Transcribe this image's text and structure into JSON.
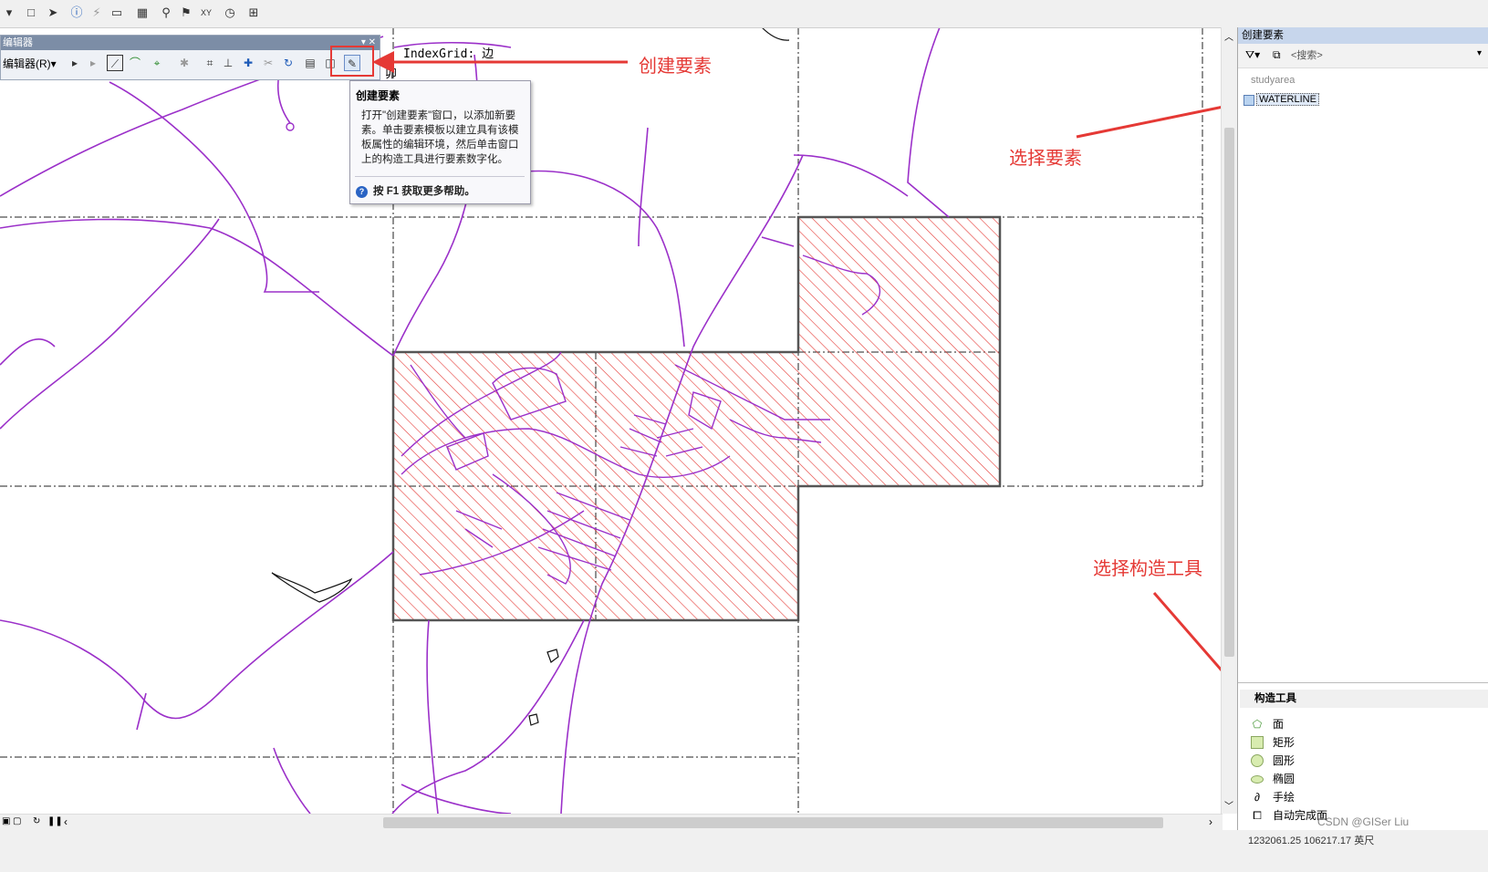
{
  "editor": {
    "title": "编辑器",
    "menu_label": "编辑器(R)▾"
  },
  "tooltip": {
    "title": "创建要素",
    "body": "打开\"创建要素\"窗口，以添加新要素。单击要素模板以建立具有该模板属性的编辑环境，然后单击窗口上的构造工具进行要素数字化。",
    "help": "按 F1 获取更多帮助。"
  },
  "map": {
    "indexgrid_label": "IndexGrid: 边",
    "indexgrid_label2": "卯"
  },
  "annotations": {
    "create_feature": "创建要素",
    "select_feature": "选择要素",
    "select_tool": "选择构造工具"
  },
  "right_panel": {
    "title": "创建要素",
    "search_placeholder": "<搜索>",
    "layers": [
      "studyarea",
      "WATERLINE"
    ],
    "construction_tools_header": "构造工具",
    "tools": [
      "面",
      "矩形",
      "圆形",
      "椭圆",
      "手绘",
      "自动完成面"
    ]
  },
  "status": {
    "coords": "1232061.25  106217.17 英尺",
    "watermark": "CSDN @GISer Liu"
  },
  "icons": {
    "tooltip_help": "help-icon",
    "tool_polygon": "polygon-icon",
    "tool_rect": "rectangle-icon",
    "tool_circle": "circle-icon",
    "tool_ellipse": "ellipse-icon",
    "tool_freehand": "freehand-icon",
    "tool_autocomplete": "autocomplete-polygon-icon"
  },
  "colors": {
    "annotation": "#e53935",
    "roads": "#9b30c9",
    "hatch": "#e53935",
    "panel_title": "#c7d6ec"
  }
}
